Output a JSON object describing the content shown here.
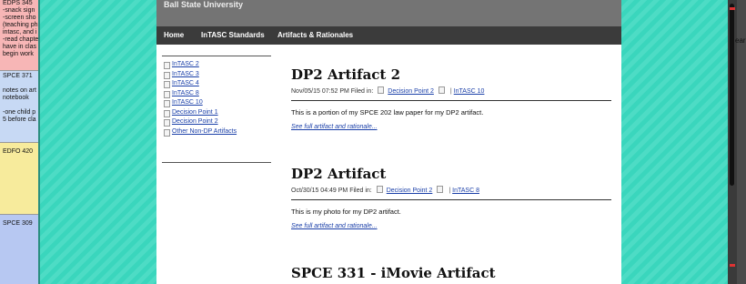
{
  "notes": [
    {
      "title": "EDPS 345",
      "body": [
        "-snack sign",
        "-screen sho",
        "(teaching ph",
        "intasc, and i",
        "-read chapte",
        "have in clas",
        "begin work"
      ]
    },
    {
      "title": "SPCE 371",
      "body": [
        "",
        "notes on art",
        "notebook",
        "",
        "-one child p",
        "5 before cla"
      ]
    },
    {
      "title": "EDFO 420",
      "body": []
    },
    {
      "title": "SPCE 309",
      "body": []
    }
  ],
  "peek_text": "ear",
  "site": {
    "title": "Ball State University",
    "nav": [
      "Home",
      "InTASC Standards",
      "Artifacts & Rationales"
    ]
  },
  "sidebar": {
    "links": [
      "InTASC 2",
      "InTASC 3",
      "InTASC 4",
      "InTASC 8",
      "InTASC 10",
      "Decision Point 1",
      "Decision Point 2",
      "Other Non-DP Artifacts"
    ]
  },
  "posts": [
    {
      "title": "DP2 Artifact 2",
      "date": "Nov/05/15 07:52 PM Filed in:",
      "cats": [
        "Decision Point 2",
        "InTASC 10"
      ],
      "excerpt": "This is a portion of my SPCE 202 law paper for my DP2 artifact.",
      "more": "See full artifact and rationale..."
    },
    {
      "title": "DP2 Artifact",
      "date": "Oct/30/15 04:49 PM Filed in:",
      "cats": [
        "Decision Point 2",
        "InTASC 8"
      ],
      "excerpt": "This is my photo for my DP2 artifact.",
      "more": "See full artifact and rationale..."
    },
    {
      "title": "SPCE 331 - iMovie Artifact"
    }
  ]
}
